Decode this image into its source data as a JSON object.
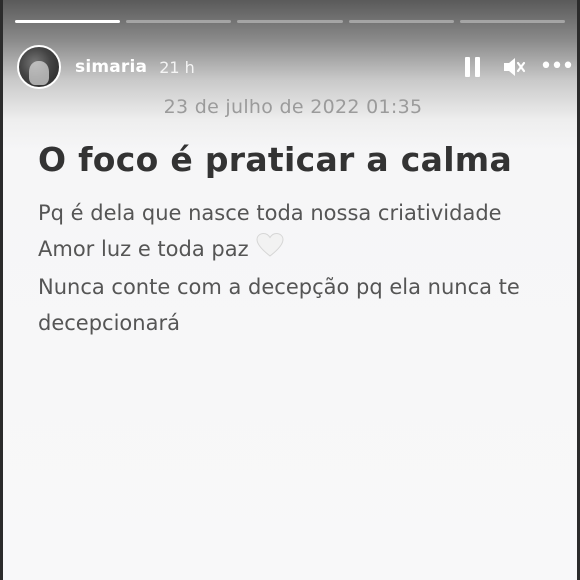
{
  "story": {
    "segments": [
      {
        "active": true
      },
      {
        "active": false
      },
      {
        "active": false
      },
      {
        "active": false
      },
      {
        "active": false
      }
    ],
    "header": {
      "username": "simaria",
      "time_ago": "21 h"
    },
    "datestamp": "23 de julho de 2022 01:35",
    "title": "O foco é praticar a calma",
    "lines": [
      "Pq é dela que nasce toda nossa criatividade",
      "Amor luz e toda paz",
      "Nunca conte com a decepção pq ela nunca te",
      "decepcionará"
    ],
    "emoji": "white-heart-icon"
  },
  "colors": {
    "title": "#333333",
    "body": "#555555",
    "datestamp": "#9b9b9b",
    "header_text": "#ffffff"
  }
}
